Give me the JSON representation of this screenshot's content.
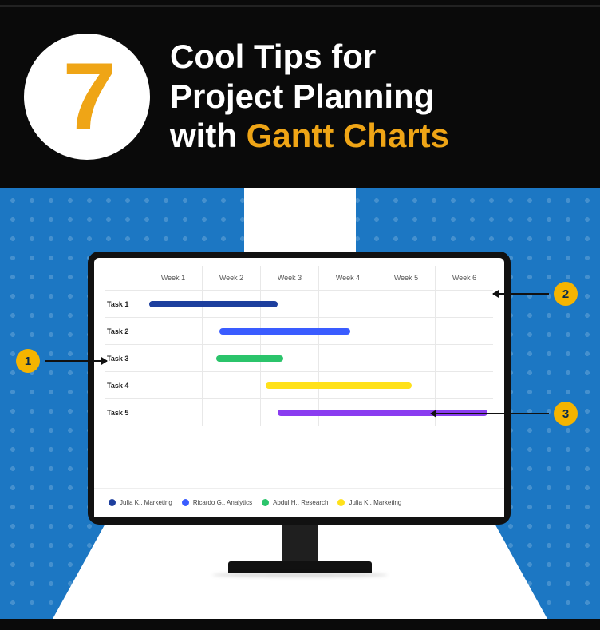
{
  "header": {
    "big_number": "7",
    "line1": "Cool Tips for",
    "line2": "Project Planning",
    "line3_prefix": "with ",
    "line3_highlight": "Gantt Charts"
  },
  "chart_data": {
    "type": "gantt",
    "columns": [
      "Week 1",
      "Week 2",
      "Week 3",
      "Week 4",
      "Week 5",
      "Week 6"
    ],
    "tasks": [
      {
        "label": "Task 1",
        "start": 0.1,
        "end": 2.3,
        "color": "#1d3f9e"
      },
      {
        "label": "Task 2",
        "start": 1.3,
        "end": 3.55,
        "color": "#3a5cff"
      },
      {
        "label": "Task 3",
        "start": 1.25,
        "end": 2.4,
        "color": "#2bc46b"
      },
      {
        "label": "Task 4",
        "start": 2.1,
        "end": 4.6,
        "color": "#ffe11a"
      },
      {
        "label": "Task 5",
        "start": 2.3,
        "end": 5.9,
        "color": "#8a3cf0"
      }
    ],
    "legend": [
      {
        "color": "#1d3f9e",
        "label": "Julia K., Marketing"
      },
      {
        "color": "#3a5cff",
        "label": "Ricardo G., Analytics"
      },
      {
        "color": "#2bc46b",
        "label": "Abdul H., Research"
      },
      {
        "color": "#ffe11a",
        "label": "Julia K., Marketing"
      }
    ]
  },
  "callouts": {
    "c1": "1",
    "c2": "2",
    "c3": "3"
  }
}
